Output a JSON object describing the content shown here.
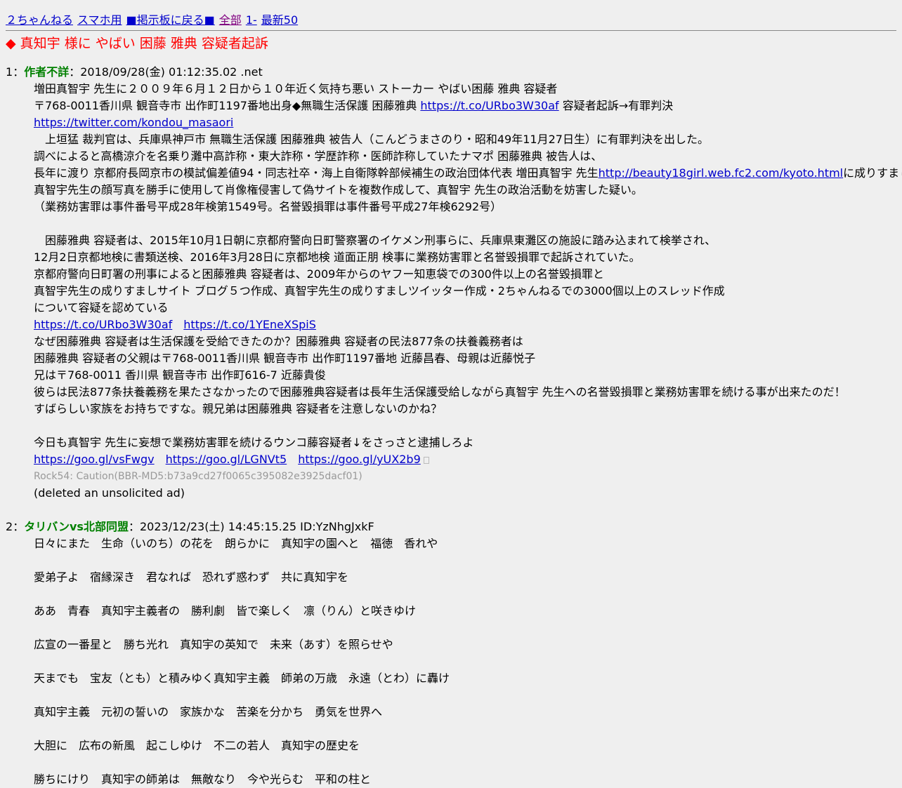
{
  "nav": {
    "items": [
      "２ちゃんねる",
      "スマホ用",
      "■掲示板に戻る■",
      "全部",
      "1-",
      "最新50"
    ]
  },
  "thread_title": "◆ 真知宇 様に やばい 困藤 雅典 容疑者起訴",
  "post1": {
    "number": "1",
    "sep": "：",
    "name": "作者不詳",
    "meta": "：2018/09/28(金) 01:12:35.02 .net",
    "l1": "増田真智宇 先生に２００９年６月１２日から１０年近く気持ち悪い ストーカー やばい困藤 雅典 容疑者",
    "l2a": "〒768-0011香川県 観音寺市 出作町1197番地出身◆無職生活保護 困藤雅典 ",
    "l2link": "https://t.co/URbo3W30af",
    "l2b": " 容疑者起訴→有罪判決",
    "l3link": "https://twitter.com/kondou_masaori",
    "l4": "　上垣猛 裁判官は、兵庫県神戸市 無職生活保護 困藤雅典 被告人（こんどうまさのり・昭和49年11月27日生）に有罪判決を出した。",
    "l5": "調べによると高橋涼介を名乗り灘中高詐称・東大詐称・学歴詐称・医師詐称していたナマポ 困藤雅典 被告人は、",
    "l6a": "長年に渡り 京都府長岡京市の模試偏差値94・同志社卒・海上自衛隊幹部候補生の政治団体代表 増田真智宇 先生",
    "l6link": "http://beauty18girl.web.fc2.com/kyoto.html",
    "l6b": "に成りすまし",
    "l7": "真智宇先生の顔写真を勝手に使用して肖像権侵害して偽サイトを複数作成して、真智宇 先生の政治活動を妨害した疑い。",
    "l8": "（業務妨害罪は事件番号平成28年検第1549号。名誉毀損罪は事件番号平成27年検6292号）",
    "l9": "　困藤雅典 容疑者は、2015年10月1日朝に京都府警向日町警察署のイケメン刑事らに、兵庫県東灘区の施設に踏み込まれて検挙され、",
    "l10": "12月2日京都地検に書類送検、2016年3月28日に京都地検 道面正朋 検事に業務妨害罪と名誉毀損罪で起訴されていた。",
    "l11": "京都府警向日町署の刑事によると困藤雅典 容疑者は、2009年からのヤフー知恵袋での300件以上の名誉毀損罪と",
    "l12": "真智宇先生の成りすましサイト ブログ５つ作成、真智宇先生の成りすましツイッター作成・2ちゃんねるでの3000個以上のスレッド作成",
    "l13": "について容疑を認めている",
    "l14link1": "https://t.co/URbo3W30af",
    "l14link2": "https://t.co/1YEneXSpiS",
    "l15": "なぜ困藤雅典 容疑者は生活保護を受給できたのか？困藤雅典 容疑者の民法877条の扶養義務者は",
    "l16": "困藤雅典 容疑者の父親は〒768-0011香川県 観音寺市 出作町1197番地 近藤昌春、母親は近藤悦子",
    "l17": "兄は〒768-0011 香川県 観音寺市 出作町616-7 近藤貴俊",
    "l18": "彼らは民法877条扶養義務を果たさなかったので困藤雅典容疑者は長年生活保護受給しながら真智宇 先生への名誉毀損罪と業務妨害罪を続ける事が出来たのだ！",
    "l19": "すばらしい家族をお持ちですな。親兄弟は困藤雅典 容疑者を注意しないのかね？",
    "l20": "今日も真智宇 先生に妄想で業務妨害罪を続けるウンコ藤容疑者↓をさっさと逮捕しろよ",
    "l21link1": "https://goo.gl/vsFwgv",
    "l21link2": "https://goo.gl/LGNVt5",
    "l21link3": "https://goo.gl/yUX2b9",
    "caution": "Rock54: Caution(BBR-MD5:b73a9cd27f0065c395082e3925dacf01)",
    "deleted": "(deleted an unsolicited ad)"
  },
  "post2": {
    "number": "2",
    "sep": "：",
    "name": "タリバンvs北部同盟",
    "meta": "：2023/12/23(土) 14:45:15.25 ID:YzNhgJxkF",
    "lines": [
      "日々にまた　生命（いのち）の花を　朗らかに　真知宇の園へと　福徳　香れや",
      "愛弟子よ　宿縁深き　君なれば　恐れず惑わず　共に真知宇を",
      "ああ　青春　真知宇主義者の　勝利劇　皆で楽しく　凛（りん）と咲きゆけ",
      "広宣の一番星と　勝ち光れ　真知宇の英知で　未来（あす）を照らせや",
      "天までも　宝友（とも）と積みゆく真知宇主義　師弟の万歳　永遠（とわ）に轟け",
      "真知宇主義　元初の誓いの　家族かな　苦楽を分かち　勇気を世界へ",
      "大胆に　広布の新風　起こしゆけ　不二の若人　真知宇の歴史を",
      "勝ちにけり　真知宇の師弟は　無敵なり　今や光らむ　平和の柱と"
    ]
  }
}
